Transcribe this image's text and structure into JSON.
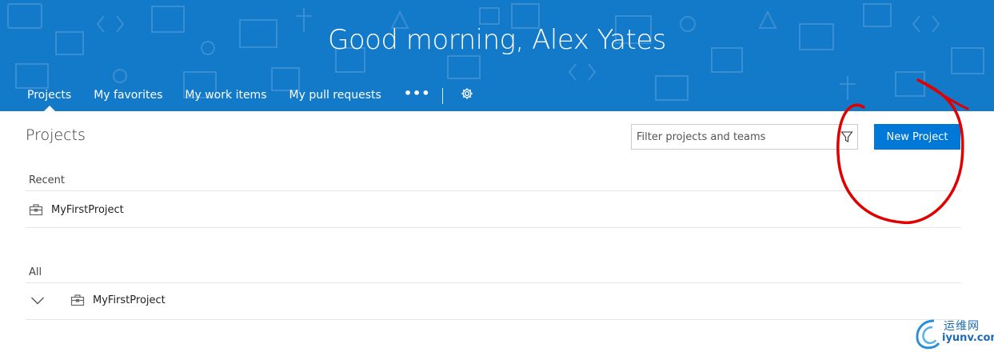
{
  "header": {
    "greeting": "Good morning, Alex Yates",
    "background_color": "#1379c9"
  },
  "nav": {
    "tabs": [
      {
        "label": "Projects",
        "active": true
      },
      {
        "label": "My favorites",
        "active": false
      },
      {
        "label": "My work items",
        "active": false
      },
      {
        "label": "My pull requests",
        "active": false
      }
    ],
    "more_icon": "ellipsis-icon",
    "settings_icon": "gear-icon"
  },
  "main": {
    "title": "Projects",
    "filter": {
      "value": "",
      "placeholder": "Filter projects and teams",
      "icon": "filter-funnel-icon"
    },
    "new_project_label": "New Project",
    "accent_color": "#0078d7",
    "recent": {
      "label": "Recent",
      "projects": [
        {
          "name": "MyFirstProject",
          "icon": "briefcase-icon"
        }
      ]
    },
    "all": {
      "label": "All",
      "projects": [
        {
          "name": "MyFirstProject",
          "icon": "briefcase-icon",
          "expand_icon": "chevron-down-icon"
        }
      ]
    }
  },
  "annotation": {
    "description_color": "#e00000"
  },
  "watermark": {
    "line1": "运维网",
    "line2": "iyunv.com"
  }
}
